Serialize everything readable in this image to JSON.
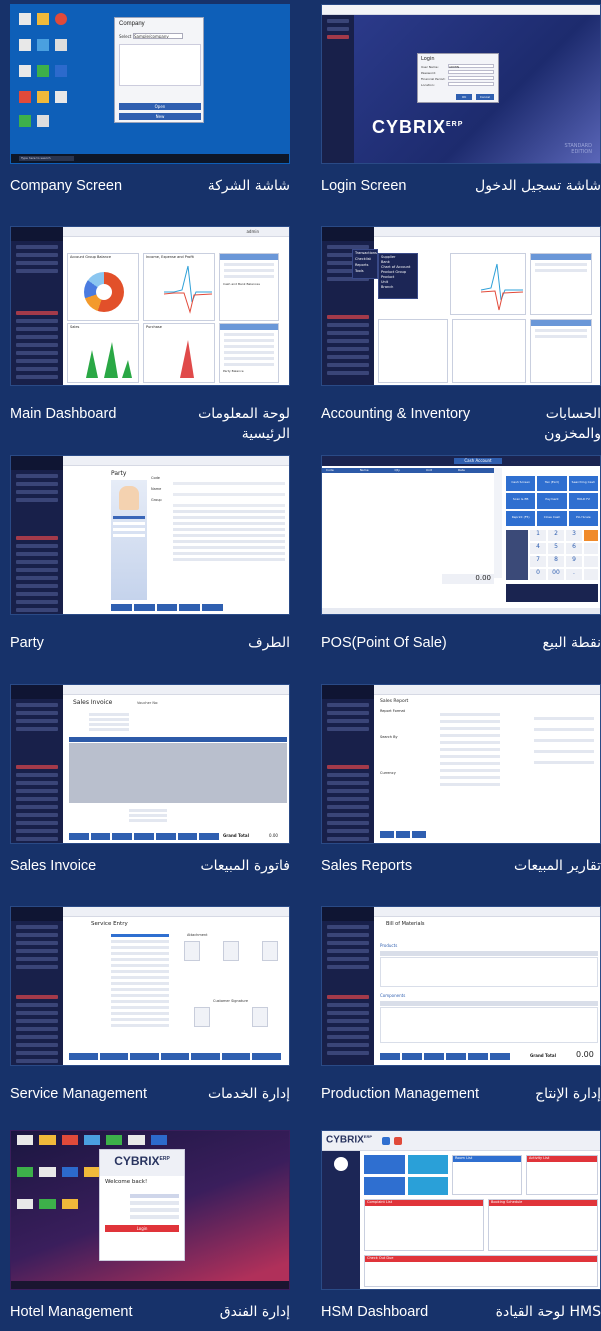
{
  "cards": [
    {
      "en": "Company Screen",
      "ar": "شاشة الشركة"
    },
    {
      "en": "Login Screen",
      "ar": "شاشة تسجيل الدخول"
    },
    {
      "en": "Main Dashboard",
      "ar": "لوحة المعلومات الرئيسية"
    },
    {
      "en": "Accounting & Inventory",
      "ar": "الحسابات والمخزون"
    },
    {
      "en": "Party",
      "ar": "الطرف"
    },
    {
      "en": "POS(Point Of Sale)",
      "ar": "نقطة البيع"
    },
    {
      "en": "Sales Invoice",
      "ar": "فاتورة المبيعات"
    },
    {
      "en": "Sales Reports",
      "ar": "تقارير المبيعات"
    },
    {
      "en": "Service Management",
      "ar": "إدارة الخدمات"
    },
    {
      "en": "Production Management",
      "ar": "إدارة الإنتاج"
    },
    {
      "en": "Hotel Management",
      "ar": "إدارة الفندق"
    },
    {
      "en": "HSM Dashboard",
      "ar": "HMS لوحة القيادة"
    }
  ],
  "shots": {
    "company": {
      "dialog_title": "Company",
      "select_label": "Select",
      "select_value": "Sample/company",
      "open": "Open",
      "new": "New",
      "search": "Type here to search"
    },
    "login": {
      "dialog_title": "Login",
      "user_label": "User Name:",
      "user_value": "ADMIN",
      "pass_label": "Password:",
      "fy_label": "Financial Period:",
      "loc_label": "Location:",
      "ok": "OK",
      "cancel": "Cancel",
      "brand": "CYBRIX",
      "brand_sub": "ERP",
      "edition": "STANDARD EDITION"
    },
    "dashboard": {
      "user": "admin",
      "section1": "Account Group Balance",
      "section2": "Income, Expense and Profit",
      "section3": "Cash and Bank Balances",
      "sales": "Sales",
      "purchase": "Purchase",
      "party": "Party Balance"
    },
    "accounting": {
      "menu": [
        "Transactions",
        "Checklist",
        "Reports",
        "Tools"
      ],
      "sub": [
        "Supplier",
        "Bank",
        "Chart of Account",
        "Product Group",
        "Product",
        "Unit",
        "Branch"
      ]
    },
    "party": {
      "title": "Party",
      "code": "Code",
      "name": "Name",
      "group": "Group"
    },
    "pos": {
      "cash_account": "Cash Account",
      "code": "Code",
      "name": "Name",
      "qty": "Qty",
      "unit": "Unit",
      "rate": "Rate",
      "amount": "Amount",
      "total": "0.00",
      "keys": [
        "1",
        "2",
        "3",
        "4",
        "5",
        "6",
        "7",
        "8",
        "9",
        "0",
        "00",
        "."
      ],
      "actions": [
        "Cash Screen",
        "Tax (Excl)",
        "Searching Cash",
        "Scan & EB",
        "Payment",
        "HOLD F2",
        "Reprint (F5)",
        "Close Cash",
        "PLU Scale"
      ]
    },
    "sales_invoice": {
      "title": "Sales Invoice",
      "voucher": "Voucher No:",
      "grand_total": "Grand Total",
      "grand_total_value": "0.00"
    },
    "sales_reports": {
      "title": "Sales Report",
      "report_format": "Report Format",
      "search_by": "Search By",
      "currency": "Currency"
    },
    "service": {
      "title": "Service Entry",
      "attachment": "Attachment",
      "signature": "Customer Signature"
    },
    "production": {
      "title": "Bill of Materials",
      "products": "Products",
      "components": "Components",
      "grand_total": "Grand Total",
      "grand_total_value": "0.00"
    },
    "hotel": {
      "welcome": "Welcome back!",
      "login": "Login",
      "brand": "CYBRIX",
      "brand_sub": "ERP"
    },
    "hsm": {
      "brand": "CYBRIX",
      "brand_sub": "ERP",
      "room_list": "Room List",
      "complaint": "Complaint List",
      "activity": "Activity List",
      "booking": "Booking Schedule",
      "check_out": "Check Out Due"
    }
  }
}
